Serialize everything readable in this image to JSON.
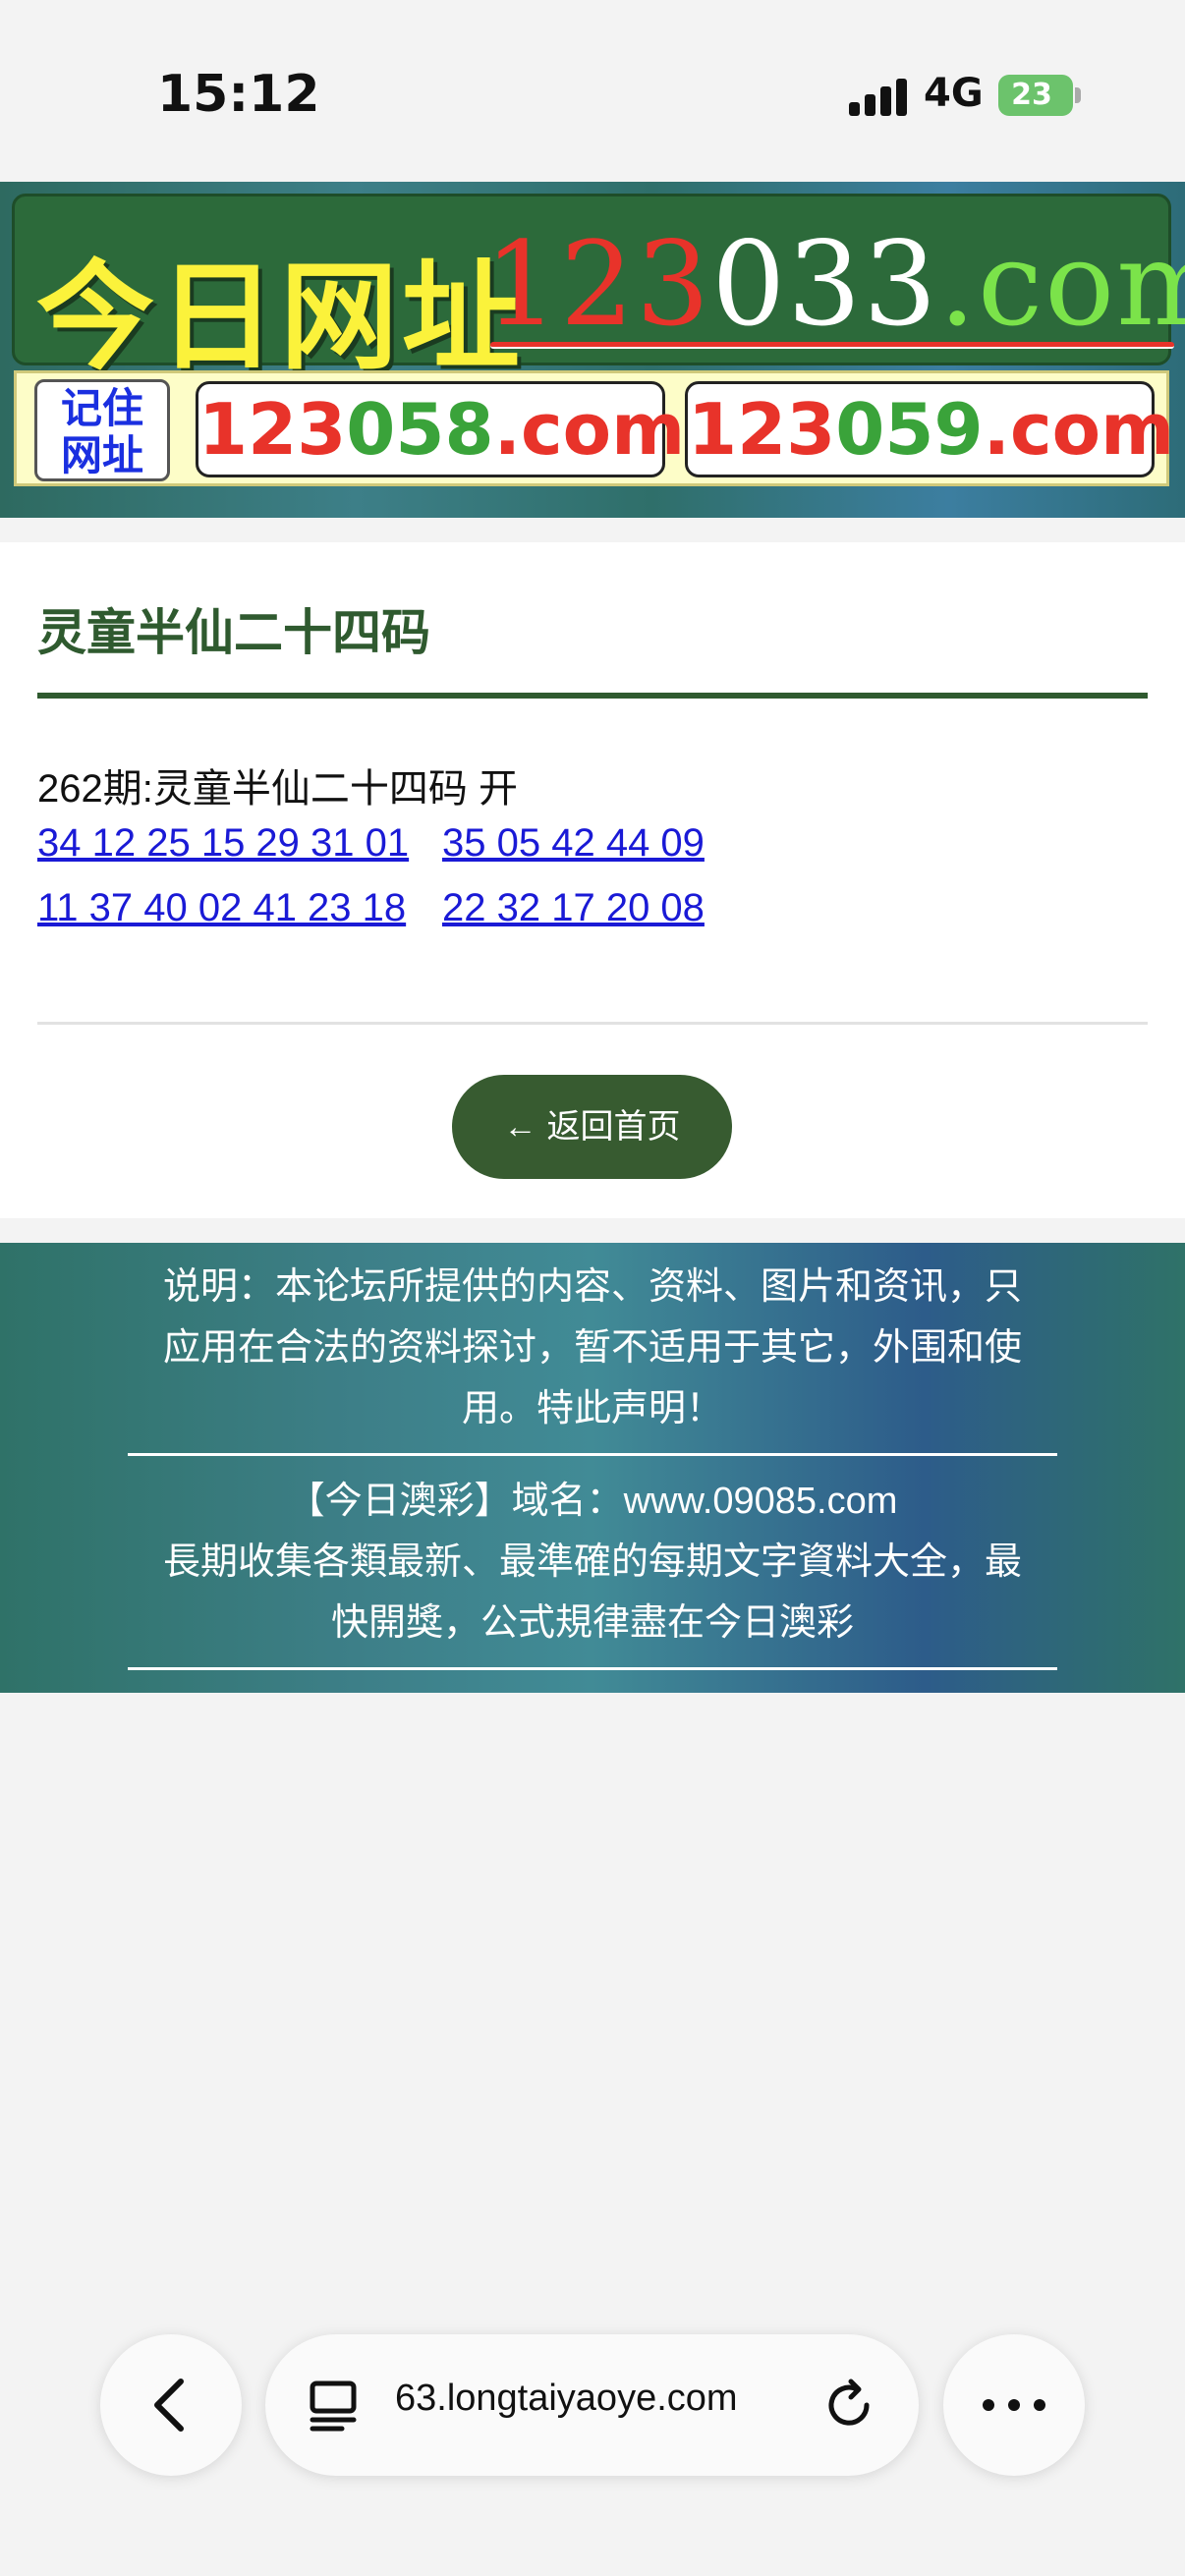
{
  "status_bar": {
    "time": "15:12",
    "network": "4G",
    "battery": "23"
  },
  "banner": {
    "title": "今日网址",
    "domain": {
      "red": "123",
      "white": "033",
      "green": ".com"
    },
    "remember": {
      "line1": "记住",
      "line2": "网址"
    },
    "domains": [
      {
        "red": "123",
        "green": "058",
        "red2": ".com"
      },
      {
        "red": "123",
        "green": "059",
        "red2": ".com"
      }
    ]
  },
  "content": {
    "title": "灵童半仙二十四码",
    "issue": "262期:灵童半仙二十四码 开",
    "numbers": [
      "34 12 25 15 29 31 01",
      "35 05 42 44 09",
      "11 37 40 02 41 23 18",
      "22 32 17 20 08"
    ],
    "back_button": "返回首页",
    "back_arrow": "←"
  },
  "notice": {
    "line1": "说明：本论坛所提供的内容、资料、图片和资讯，只",
    "line2": "应用在合法的资料探讨，暂不适用于其它，外围和使",
    "line3": "用。特此声明！",
    "line4": "【今日澳彩】域名：www.09085.com",
    "line5": "長期收集各類最新、最準確的每期文字資料大全，最",
    "line6": "快開獎，公式規律盡在今日澳彩"
  },
  "browser": {
    "url": "63.longtaiyaoye.com",
    "icons": [
      "back-icon",
      "tabs-icon",
      "reload-icon",
      "more-icon"
    ]
  },
  "colors": {
    "title_green": "#2f5a2f",
    "button_green": "#375b30",
    "link_blue": "#1a1ad6",
    "banner_red": "#e8332a",
    "banner_yellow": "#fbf23b"
  }
}
